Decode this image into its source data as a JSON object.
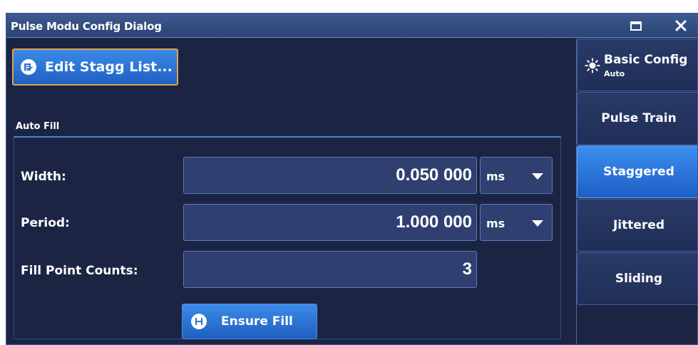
{
  "dialog": {
    "title": "Pulse Modu Config Dialog",
    "maximize_icon": "maximize-icon",
    "close_icon": "close-icon",
    "close_glyph": "✕"
  },
  "toolbar": {
    "edit_stagg_label": "Edit Stagg List...",
    "edit_icon": "edit-list-icon"
  },
  "auto_fill": {
    "section_label": "Auto Fill",
    "width": {
      "label": "Width:",
      "value": "0.050 000",
      "unit": "ms"
    },
    "period": {
      "label": "Period:",
      "value": "1.000 000",
      "unit": "ms"
    },
    "fill_point_counts": {
      "label": "Fill Point Counts:",
      "value": "3"
    },
    "ensure_fill_label": "Ensure Fill",
    "ensure_icon": "ensure-fill-icon"
  },
  "sidebar": {
    "items": [
      {
        "label": "Basic Config",
        "sub": "Auto",
        "icon": "sun-icon",
        "active": false
      },
      {
        "label": "Pulse Train",
        "active": false
      },
      {
        "label": "Staggered",
        "active": true
      },
      {
        "label": "Jittered",
        "active": false
      },
      {
        "label": "Sliding",
        "active": false
      }
    ]
  },
  "colors": {
    "background": "#1b2543",
    "accent_blue": "#2f7be0",
    "focus_orange": "#e0a24e",
    "title_bar": "#34508a"
  }
}
